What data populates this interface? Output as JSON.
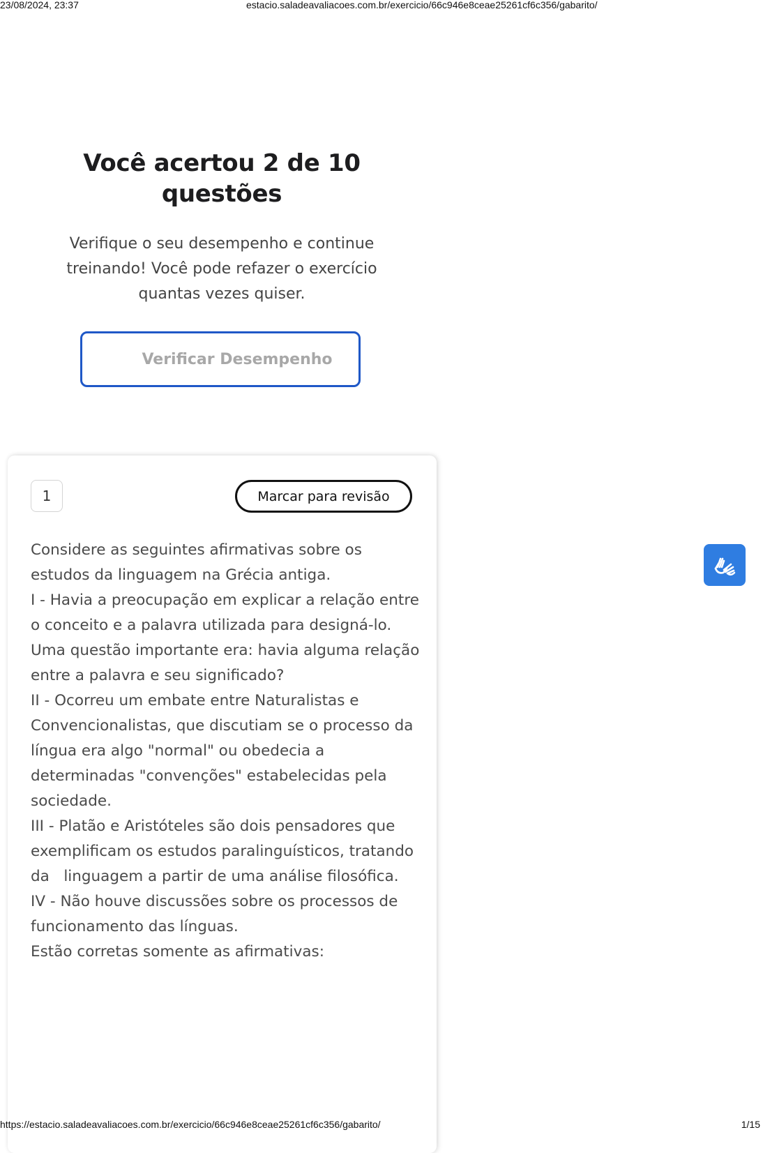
{
  "print": {
    "datetime": "23/08/2024, 23:37",
    "header_url": "estacio.saladeavaliacoes.com.br/exercicio/66c946e8ceae25261cf6c356/gabarito/",
    "footer_url": "https://estacio.saladeavaliacoes.com.br/exercicio/66c946e8ceae25261cf6c356/gabarito/",
    "page_count": "1/15"
  },
  "result": {
    "title": "Você acertou 2 de 10 questões",
    "subtitle": "Verifique o seu desempenho e continue treinando! Você pode refazer o exercício quantas vezes quiser.",
    "verify_button": "Verificar Desempenho"
  },
  "question": {
    "number": "1",
    "review_button": "Marcar para revisão",
    "paragraphs": [
      "Considere as seguintes afirmativas sobre os estudos da linguagem na Grécia antiga.",
      "I - Havia a preocupação em explicar a relação entre o conceito e a palavra utilizada para designá-lo. Uma questão importante era: havia alguma relação entre a palavra e seu significado?",
      "II - Ocorreu um embate entre Naturalistas e Convencionalistas, que discutiam se o processo da língua era algo \"normal\" ou obedecia a determinadas \"convenções\" estabelecidas pela sociedade.",
      "III - Platão e Aristóteles são dois pensadores que exemplificam os estudos paralinguísticos, tratando da   linguagem a partir de uma análise filosófica.",
      "IV - Não houve discussões sobre os processos de funcionamento das línguas.",
      "Estão corretas somente as afirmativas:"
    ]
  },
  "colors": {
    "primary_blue": "#1f58c7",
    "accessibility_blue": "#2f7de1",
    "muted_text": "#a8a8a8",
    "body_text": "#4a4a4a"
  },
  "icons": {
    "accessibility": "sign-language-hands-icon"
  }
}
